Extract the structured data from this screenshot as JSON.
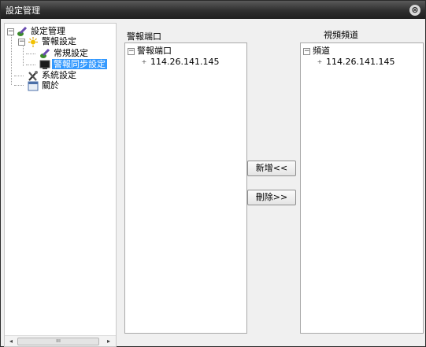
{
  "window": {
    "title": "設定管理",
    "close_glyph": "⊗"
  },
  "tree": {
    "root": {
      "expander": "−",
      "label": "設定管理"
    },
    "alarm": {
      "expander": "−",
      "label": "警報設定"
    },
    "general": {
      "label": "常規設定"
    },
    "alarm_sync": {
      "label": "警報同步設定"
    },
    "system": {
      "label": "系統設定"
    },
    "about": {
      "label": "關於"
    }
  },
  "alarm_ports": {
    "header": "警報端口",
    "root_label": "警報端口",
    "root_expander": "−",
    "items": [
      {
        "expander": "+",
        "label": "114.26.141.145"
      }
    ]
  },
  "video_channels": {
    "header": "視頻頻道",
    "root_label": "頻道",
    "root_expander": "−",
    "items": [
      {
        "expander": "+",
        "label": "114.26.141.145"
      }
    ]
  },
  "buttons": {
    "add": "新增<<",
    "delete": "刪除>>"
  },
  "scrollbar": {
    "left": "◂",
    "thumb": "ııı",
    "right": "▸"
  }
}
